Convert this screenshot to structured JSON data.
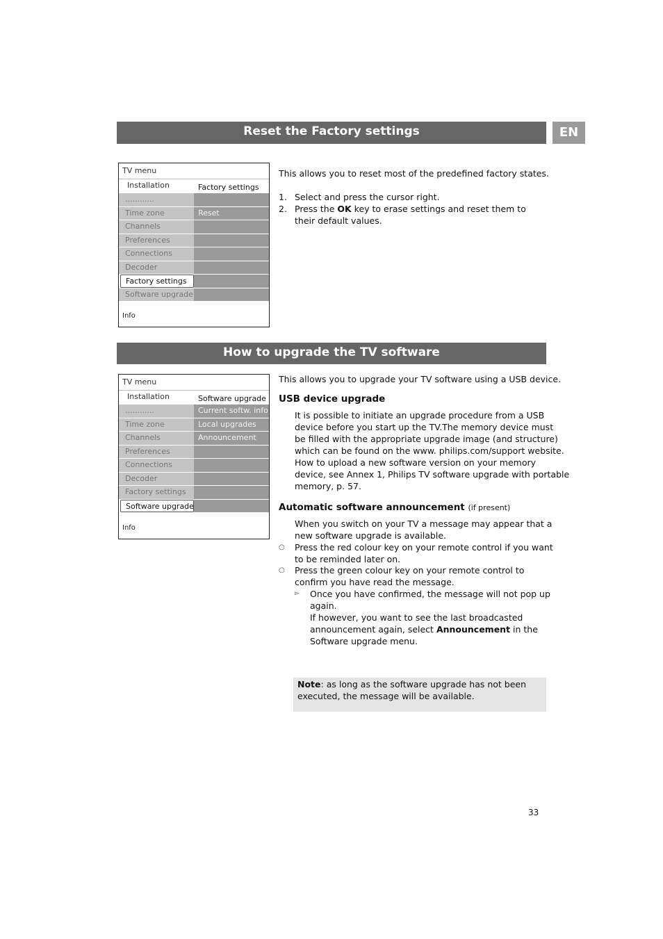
{
  "language_tab": "EN",
  "section1": {
    "title": "Reset the Factory settings",
    "menu": {
      "title": "TV menu",
      "header_left": "Installation",
      "header_right": "Factory settings",
      "rows": [
        {
          "left": "............",
          "right": ""
        },
        {
          "left": "Time zone",
          "right": "Reset"
        },
        {
          "left": "Channels",
          "right": ""
        },
        {
          "left": "Preferences",
          "right": ""
        },
        {
          "left": "Connections",
          "right": ""
        },
        {
          "left": "Decoder",
          "right": ""
        },
        {
          "left": "Factory settings",
          "right": "",
          "selected": true
        },
        {
          "left": "Software upgrade",
          "right": ""
        }
      ],
      "info": "Info"
    },
    "intro": "This allows you to reset most of the predefined factory states.",
    "steps": [
      {
        "num": "1.",
        "text": "Select and press the cursor right."
      },
      {
        "num": "2.",
        "pre": "Press the ",
        "bold": "OK",
        "post": " key to erase settings and reset them to their default values."
      }
    ]
  },
  "section2": {
    "title": "How to upgrade the TV software",
    "menu": {
      "title": "TV menu",
      "header_left": "Installation",
      "header_right": "Software upgrade",
      "rows": [
        {
          "left": "............",
          "right": "Current softw. info"
        },
        {
          "left": "Time zone",
          "right": "Local upgrades"
        },
        {
          "left": "Channels",
          "right": "Announcement"
        },
        {
          "left": "Preferences",
          "right": ""
        },
        {
          "left": "Connections",
          "right": ""
        },
        {
          "left": "Decoder",
          "right": ""
        },
        {
          "left": "Factory settings",
          "right": ""
        },
        {
          "left": "Software upgrade",
          "right": "",
          "selected": true
        }
      ],
      "info": "Info"
    },
    "intro": "This allows you to upgrade your TV software using a USB device.",
    "usb_heading": "USB device upgrade",
    "usb_lines": [
      "It is possible to initiate an upgrade procedure from a USB",
      "device before you start up the TV.The memory device must",
      "be filled with the appropriate upgrade image (and structure)",
      "which can be found on the www. philips.com/support website.",
      "How to upload a new software version on your memory",
      "device, see Annex 1, Philips TV software upgrade with portable",
      "memory, p. 57."
    ],
    "auto_heading": "Automatic software announcement",
    "auto_heading_suffix": "(if present)",
    "auto_intro_lines": [
      "When you switch on your TV a message may appear that a",
      "new software upgrade is available."
    ],
    "bullets": [
      {
        "line1": "Press the red colour key on your remote control if you want",
        "line2": "to be reminded later on."
      },
      {
        "line1": "Press the green colour key on your remote control to",
        "line2": "confirm you have read the message."
      }
    ],
    "result_lines": [
      "Once you have confirmed, the message will not pop up",
      "again.",
      "If however, you want to see the last broadcasted"
    ],
    "result_line4_pre": "announcement again, select ",
    "result_line4_bold": "Announcement",
    "result_line4_post": " in the",
    "result_line5": "Software upgrade menu.",
    "note_label": "Note",
    "note_line1": ": as long as the software upgrade has not been",
    "note_line2": "executed, the message will be available."
  },
  "page_number": "33"
}
